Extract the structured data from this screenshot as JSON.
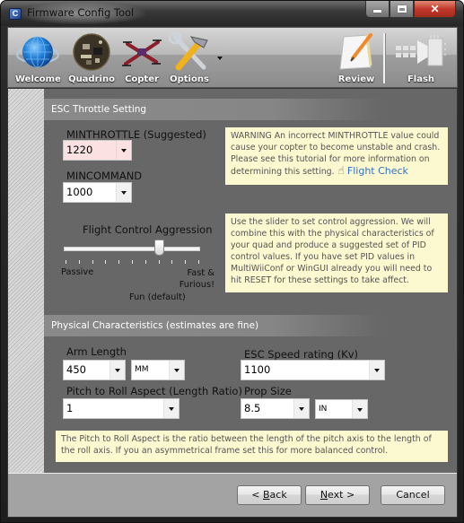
{
  "window": {
    "title": "Firmware Config Tool",
    "app_icon_glyph": "C",
    "controls": {
      "minimize": "minimize",
      "maximize": "maximize",
      "close": "✕"
    }
  },
  "toolbar": {
    "items": [
      {
        "label": "Welcome",
        "icon": "globe-icon"
      },
      {
        "label": "Quadrino",
        "icon": "circuit-board-icon"
      },
      {
        "label": "Copter",
        "icon": "quadcopter-icon"
      },
      {
        "label": "Options",
        "icon": "tools-icon"
      },
      {
        "label": "Review",
        "icon": "notepad-pencil-icon"
      },
      {
        "label": "Flash",
        "icon": "chip-flash-icon"
      }
    ]
  },
  "esc_section": {
    "title": "ESC Throttle Setting",
    "minthrottle": {
      "label": "MINTHROTTLE (Suggested)",
      "value": "1220"
    },
    "mincommand": {
      "label": "MINCOMMAND",
      "value": "1000"
    },
    "warning": {
      "text": "WARNING  An incorrect MINTHROTTLE value could cause your copter to become unstable and crash. Please see this tutorial for more information on determining this setting.",
      "link_label": "Flight Check",
      "link_color": "#2e73c8"
    },
    "aggression": {
      "label": "Flight Control Aggression",
      "min_label": "Passive",
      "max_label": "Fast & Furious!",
      "default_label": "Fun (default)",
      "value": 7,
      "min": 0,
      "max": 10
    },
    "aggression_note": "Use the slider to set control aggression. We will combine this with the physical characteristics of your quad and produce a suggested set of PID control values. If you have set PID values in MultiWiiConf or WinGUI already you will need to hit RESET for these settings to take affect."
  },
  "physical_section": {
    "title": "Physical Characteristics (estimates are fine)",
    "arm_length": {
      "label": "Arm Length",
      "value": "450",
      "unit": "MM"
    },
    "esc_speed": {
      "label": "ESC Speed rating (Kv)",
      "value": "1100"
    },
    "pitch_roll": {
      "label": "Pitch to Roll Aspect (Length Ratio)",
      "value": "1"
    },
    "prop_size": {
      "label": "Prop Size",
      "value": "8.5",
      "unit": "IN"
    },
    "note": "The Pitch to Roll Aspect is the ratio between the length of the pitch axis to the length of the roll axis. If you an asymmetrical frame set this for more balanced control."
  },
  "buttons": {
    "back_prefix": "< ",
    "back_mnemonic": "B",
    "back_rest": "ack",
    "next_mnemonic": "N",
    "next_rest": "ext >",
    "cancel": "Cancel"
  },
  "colors": {
    "content_bg": "#676767",
    "note_bg": "#fcf8d0",
    "minthrottle_bg": "#fbe1e1"
  }
}
